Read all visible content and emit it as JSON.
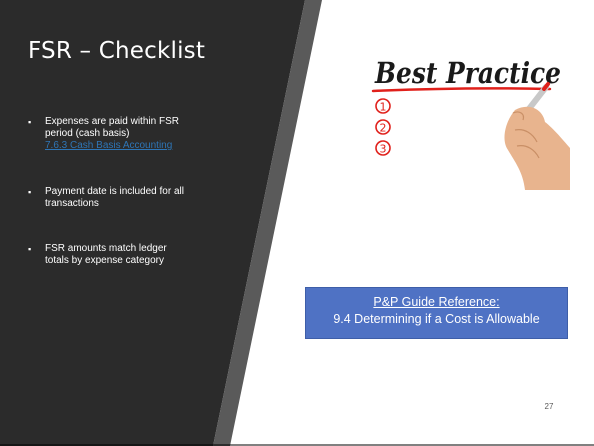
{
  "slide": {
    "title": "FSR – Checklist",
    "bullets": [
      {
        "text": "Expenses are paid within FSR period (cash basis)",
        "link": "7.6.3 Cash Basis Accounting"
      },
      {
        "text": "Payment date is included for all transactions"
      },
      {
        "text": "FSR amounts match ledger totals by expense category"
      }
    ],
    "image": {
      "heading": "Best Practice",
      "numbers": [
        "1",
        "2",
        "3"
      ]
    },
    "reference_box": {
      "line1": "P&P Guide Reference:",
      "line2": "9.4 Determining if a Cost is Allowable"
    },
    "page_number": "27"
  },
  "colors": {
    "dark_panel": "#2b2b2b",
    "accent_stripe": "#595959",
    "link": "#2e75b6",
    "box_fill": "#4f72c4",
    "marker_red": "#e0201b"
  }
}
